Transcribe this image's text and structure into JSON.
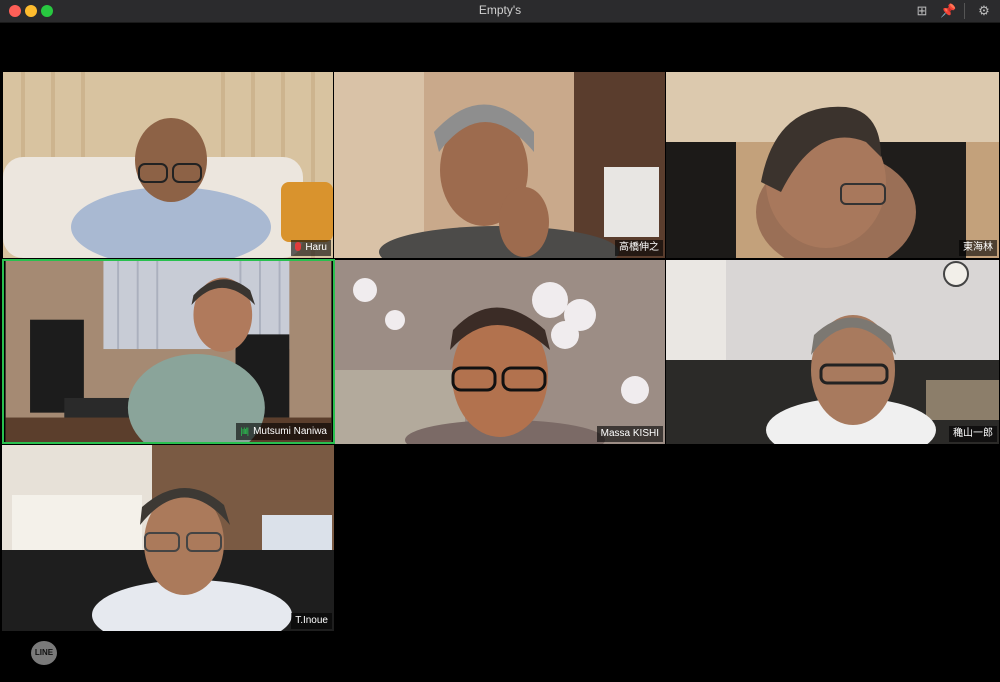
{
  "window": {
    "title": "Empty's"
  },
  "participants": [
    {
      "name": "Haru",
      "muted": true
    },
    {
      "name": "高橋伸之"
    },
    {
      "name": "東海林"
    },
    {
      "name": "Mutsumi Naniwa",
      "speaking": true
    },
    {
      "name": "Massa KISHI"
    },
    {
      "name": "穐山一郎"
    },
    {
      "name": "T.Inoue"
    }
  ],
  "watermark": {
    "text": "LINE"
  },
  "colors": {
    "active_border": "#2ac04f",
    "muted_icon": "#e23b3b",
    "titlebar": "#2b2b2d"
  }
}
